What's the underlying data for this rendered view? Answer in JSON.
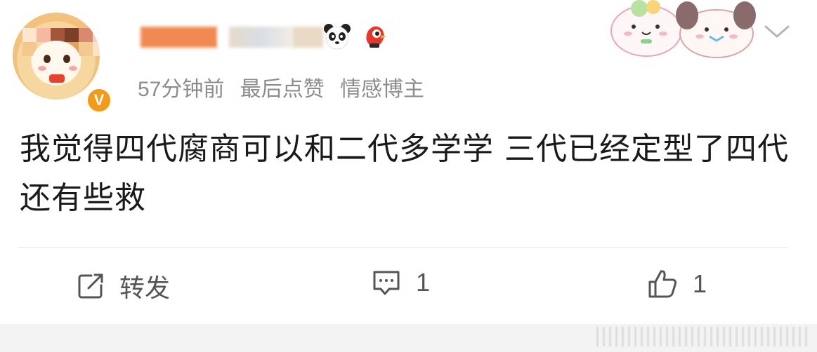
{
  "post": {
    "meta": {
      "time": "57分钟前",
      "tag_top_like": "最后点赞",
      "tag_blogger": "情感博主"
    },
    "verified_mark": "V",
    "content": "我觉得四代腐商可以和二代多学学 三代已经定型了四代还有些救",
    "actions": {
      "repost_label": "转发",
      "comment_count": "1",
      "like_count": "1"
    }
  },
  "icons": {
    "menu": "chevron-down-icon",
    "repost": "repost-icon",
    "comment": "comment-icon",
    "like": "thumbs-up-icon"
  },
  "colors": {
    "meta_text": "#8c8c8c",
    "content_text": "#1a1a1a",
    "verified": "#f39a1a",
    "divider": "#e6e6e6"
  }
}
